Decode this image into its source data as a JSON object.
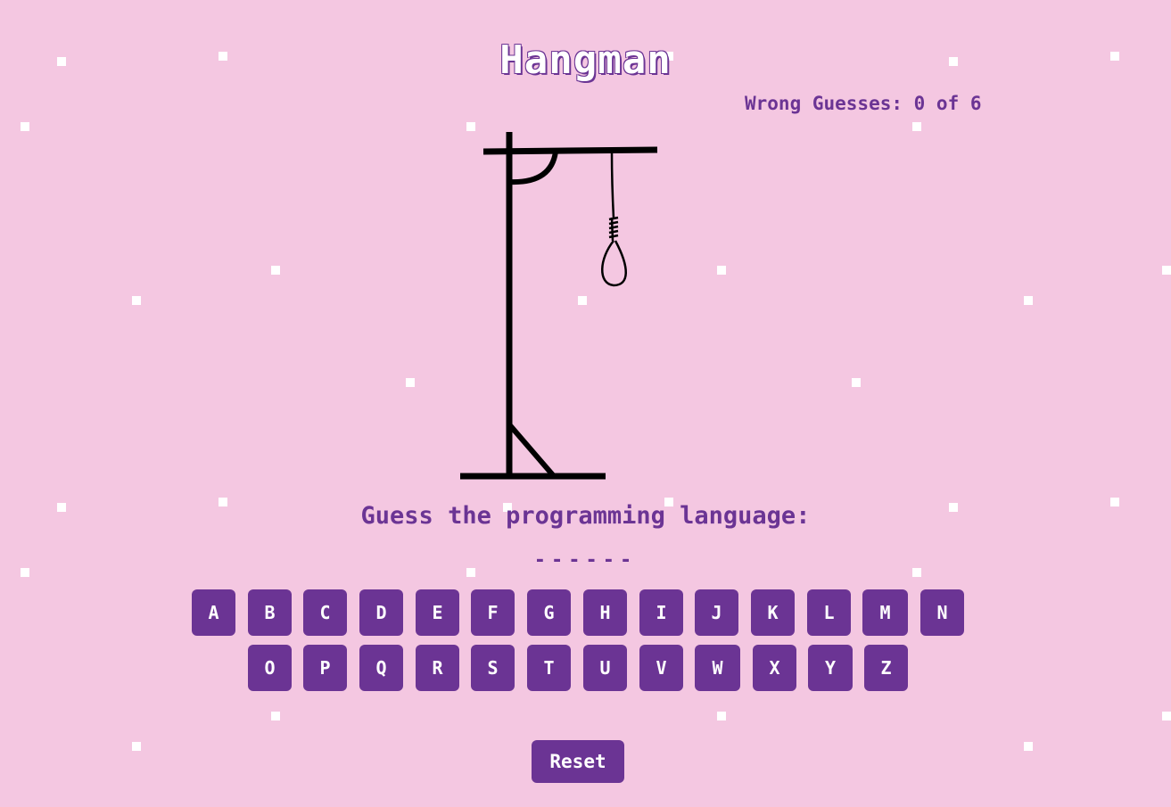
{
  "game": {
    "title": "Hangman",
    "wrong_guesses_label": "Wrong Guesses: 0 of 6",
    "wrong_guesses": 0,
    "max_wrong_guesses": 6,
    "prompt": "Guess the programming language:",
    "word_mask": "------",
    "reset_label": "Reset"
  },
  "keyboard": {
    "row1": [
      "A",
      "B",
      "C",
      "D",
      "E",
      "F",
      "G",
      "H",
      "I",
      "J",
      "K",
      "L",
      "M",
      "N"
    ],
    "row2": [
      "O",
      "P",
      "Q",
      "R",
      "S",
      "T",
      "U",
      "V",
      "W",
      "X",
      "Y",
      "Z"
    ]
  },
  "colors": {
    "background": "#f4c7e1",
    "accent": "#6b3494",
    "key_text": "#ffffff"
  }
}
